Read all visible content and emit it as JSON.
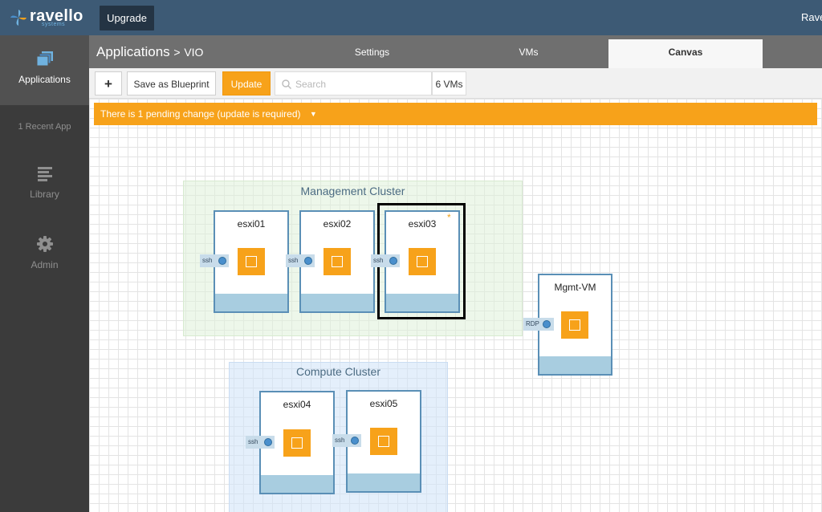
{
  "brand": {
    "name": "ravello",
    "sub": "systems",
    "user": "Ravel"
  },
  "topbar": {
    "upgrade_label": "Upgrade"
  },
  "sidebar": {
    "items": [
      {
        "label": "Applications",
        "icon": "applications-icon"
      },
      {
        "label": "1 Recent App"
      },
      {
        "label": "Library",
        "icon": "library-icon"
      },
      {
        "label": "Admin",
        "icon": "gear-icon"
      }
    ]
  },
  "header": {
    "breadcrumb_root": "Applications",
    "breadcrumb_sep": ">",
    "breadcrumb_leaf": "VIO",
    "tabs": [
      {
        "label": "Settings"
      },
      {
        "label": "VMs"
      },
      {
        "label": "Canvas",
        "active": true
      }
    ]
  },
  "toolbar": {
    "add_label": "+",
    "blueprint_label": "Save as Blueprint",
    "update_label": "Update",
    "search_placeholder": "Search",
    "vm_count": "6 VMs"
  },
  "banner": {
    "text": "There is 1 pending change (update is required)"
  },
  "clusters": [
    {
      "title": "Management Cluster"
    },
    {
      "title": "Compute Cluster"
    }
  ],
  "vms": [
    {
      "name": "esxi01",
      "service": "ssh"
    },
    {
      "name": "esxi02",
      "service": "ssh"
    },
    {
      "name": "esxi03",
      "service": "ssh",
      "pending_mark": "*"
    },
    {
      "name": "Mgmt-VM",
      "service": "RDP"
    },
    {
      "name": "esxi04",
      "service": "ssh"
    },
    {
      "name": "esxi05",
      "service": "ssh"
    }
  ],
  "colors": {
    "accent": "#f7a21a",
    "topbar": "#3d5a75",
    "sidebar": "#3b3b3b",
    "vm_border": "#5a8fb6"
  }
}
